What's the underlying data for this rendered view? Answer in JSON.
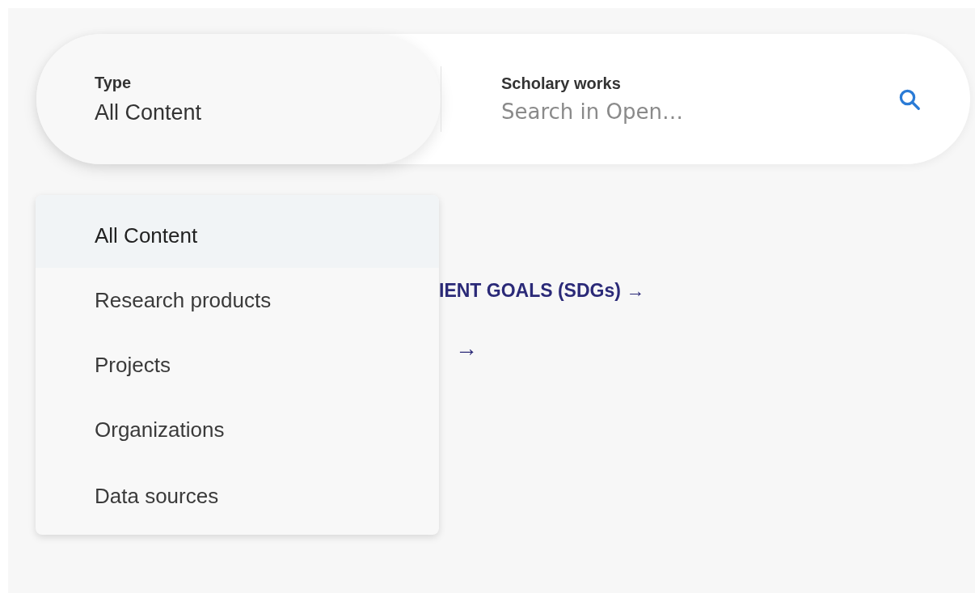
{
  "search": {
    "type_label": "Type",
    "type_value": "All Content",
    "query_label": "Scholary works",
    "query_placeholder": "Search in Open…"
  },
  "links": [
    {
      "text": "IENT GOALS (SDGs) →"
    },
    {
      "text": "→"
    }
  ],
  "type_menu": [
    {
      "label": "All Content",
      "selected": true
    },
    {
      "label": "Research products",
      "selected": false
    },
    {
      "label": "Projects",
      "selected": false
    },
    {
      "label": "Organizations",
      "selected": false
    },
    {
      "label": "Data sources",
      "selected": false
    }
  ]
}
